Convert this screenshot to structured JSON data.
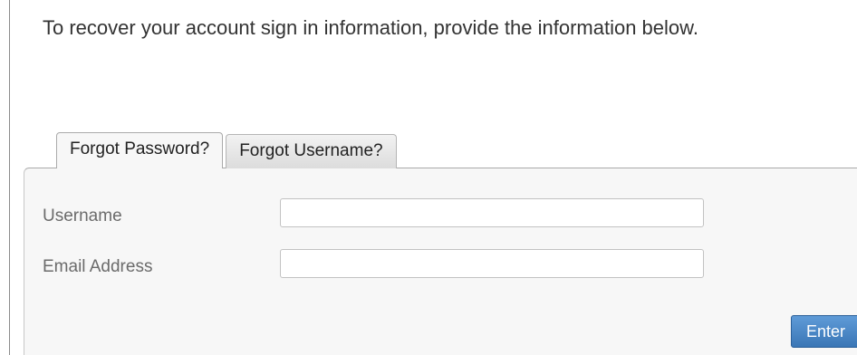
{
  "intro": {
    "text": "To recover your account sign in information, provide the information below."
  },
  "tabs": [
    {
      "label": "Forgot Password?",
      "active": true
    },
    {
      "label": "Forgot Username?",
      "active": false
    }
  ],
  "form": {
    "username": {
      "label": "Username",
      "value": "",
      "placeholder": ""
    },
    "email": {
      "label": "Email Address",
      "value": "",
      "placeholder": ""
    },
    "submit_label": "Enter"
  },
  "colors": {
    "button": "#4a88c9",
    "panel_background": "#f7f7f7",
    "label_text": "#6b6b6b"
  }
}
